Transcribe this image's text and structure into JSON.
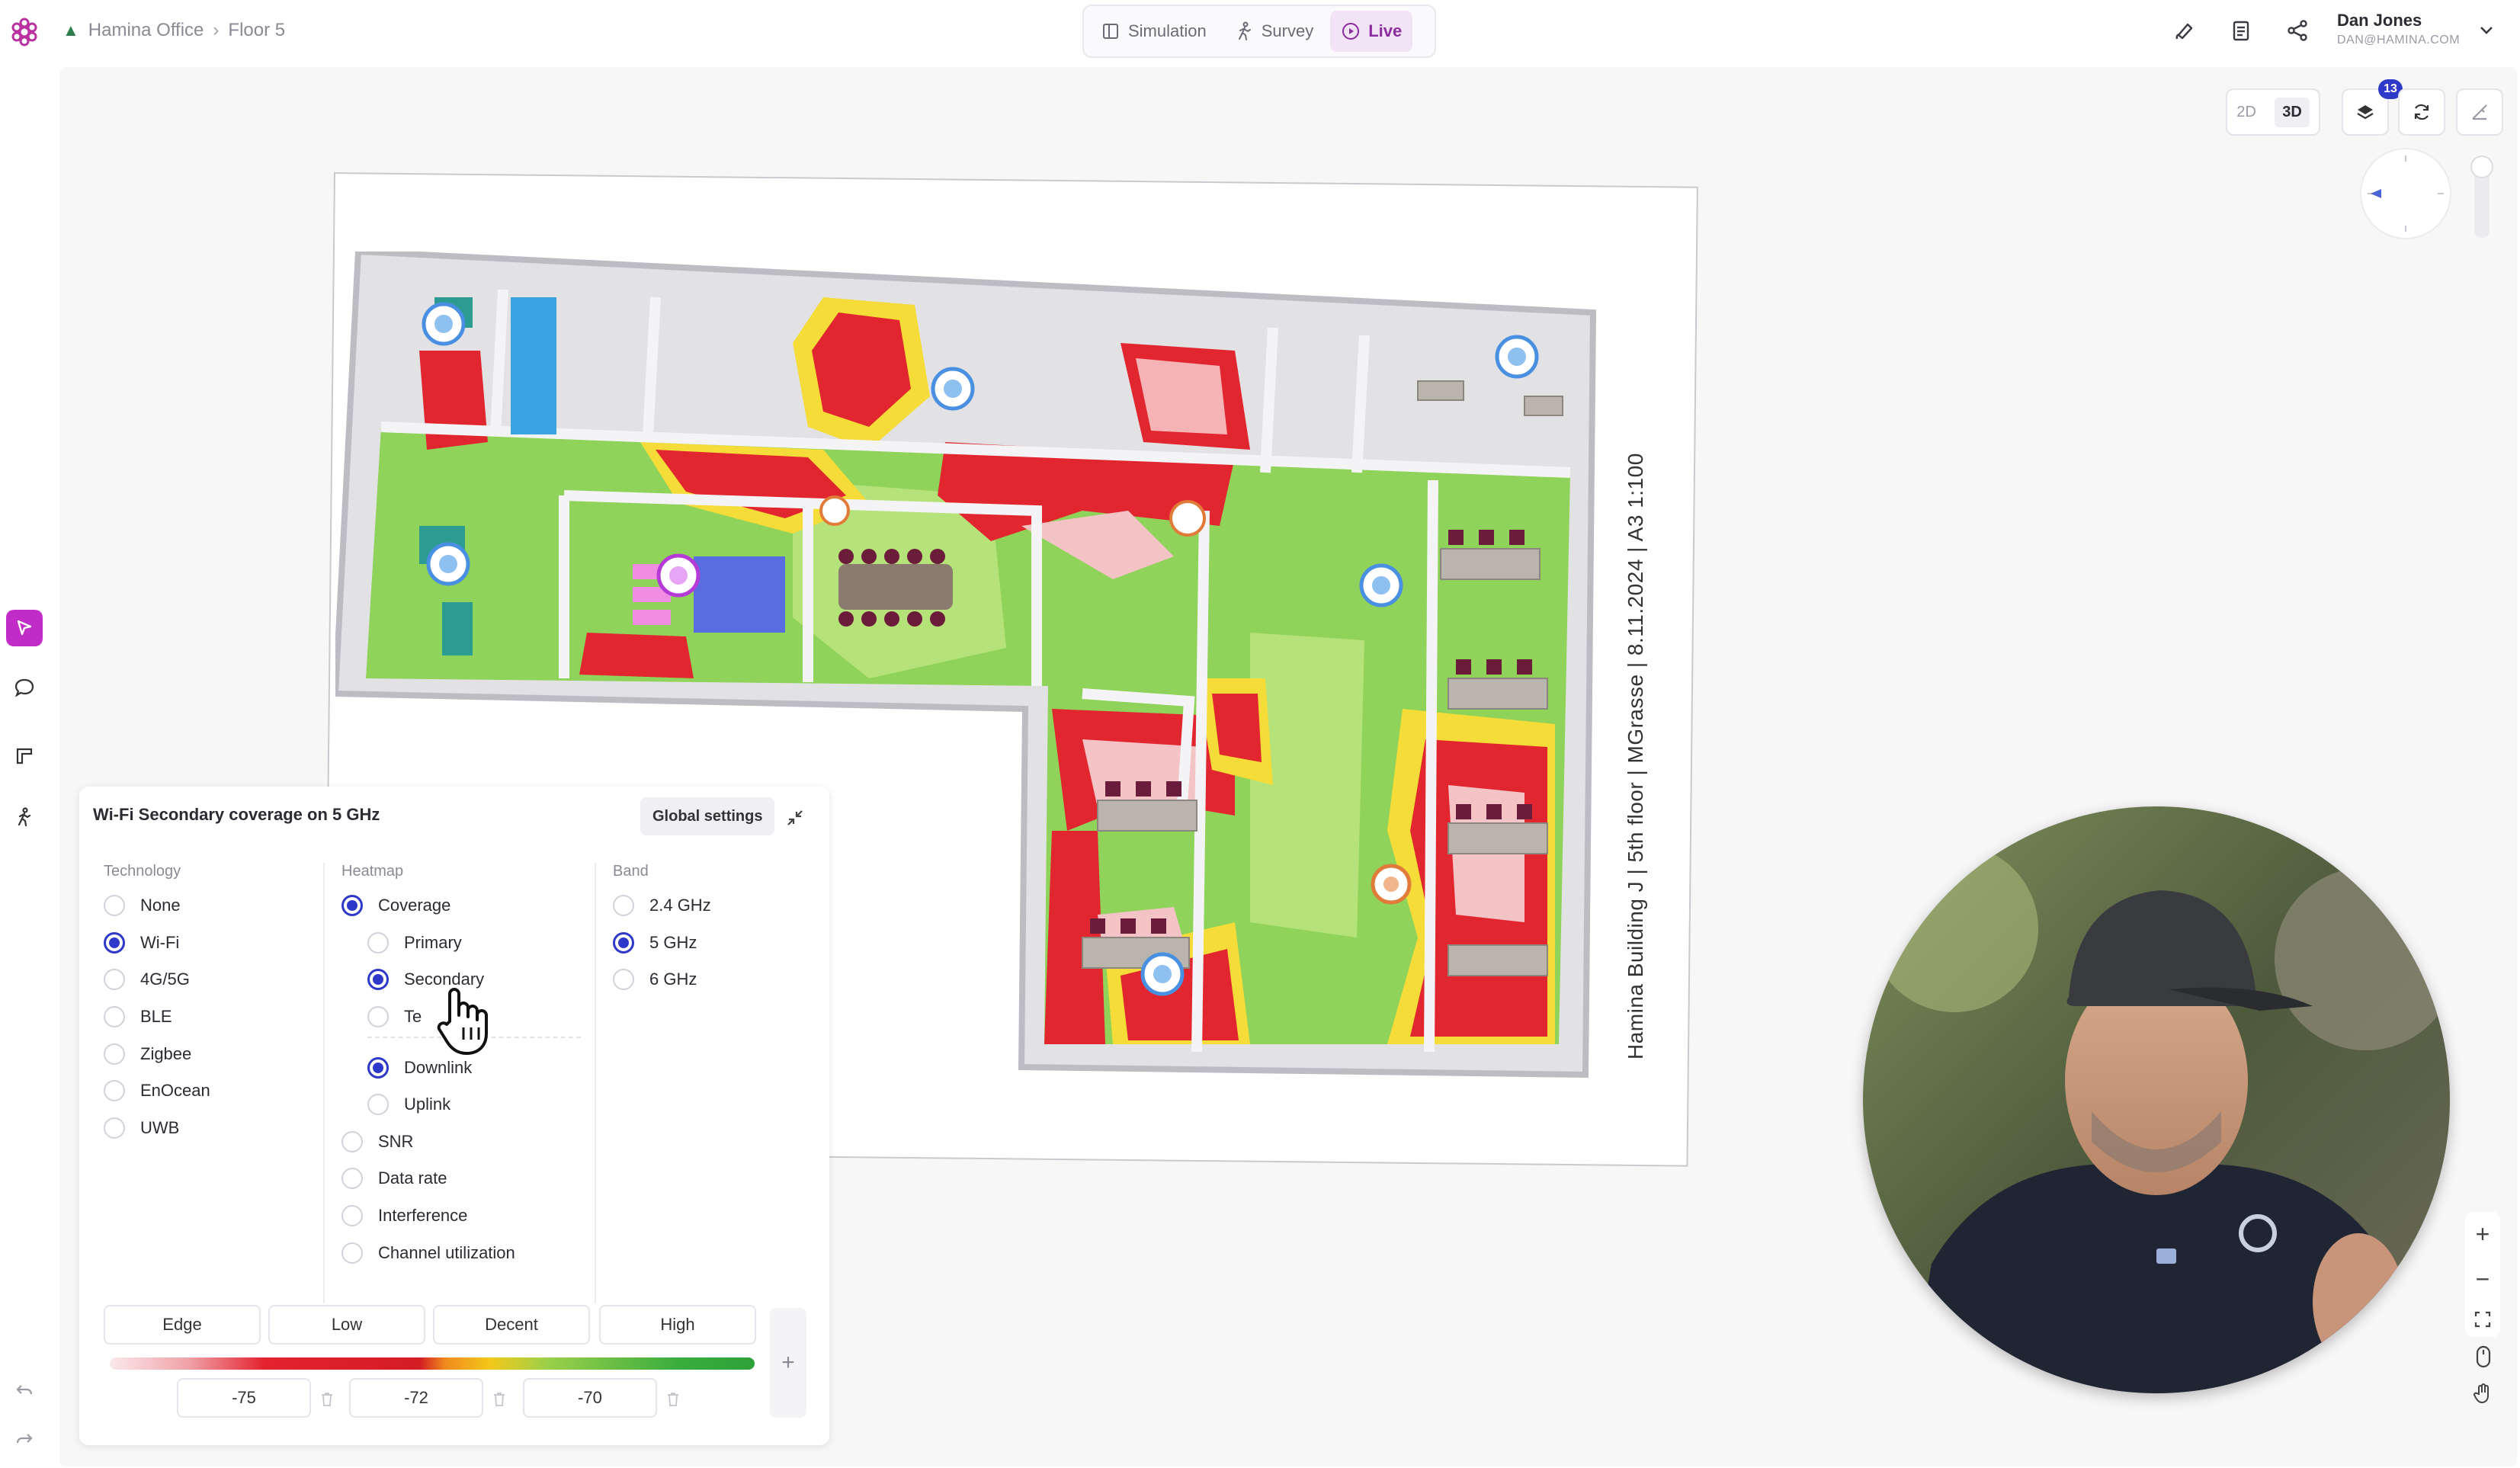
{
  "breadcrumb": {
    "project": "Hamina Office",
    "floor": "Floor 5"
  },
  "modes": [
    {
      "label": "Simulation",
      "icon": "book-icon",
      "active": false
    },
    {
      "label": "Survey",
      "icon": "walker-icon",
      "active": false
    },
    {
      "label": "Live",
      "icon": "play-circle-icon",
      "active": true
    }
  ],
  "user": {
    "name": "Dan Jones",
    "email": "DAN@HAMINA.COM"
  },
  "view": {
    "two_d": "2D",
    "three_d": "3D",
    "active": "3D",
    "layers_count": "13"
  },
  "floorplan": {
    "caption": "Hamina Building J | 5th floor | MGrasse | 8.11.2024 | A3 1:100"
  },
  "panel": {
    "title": "Wi-Fi Secondary coverage on 5 GHz",
    "global_settings": "Global settings",
    "technology": {
      "header": "Technology",
      "selected": "Wi-Fi",
      "options": [
        "None",
        "Wi-Fi",
        "4G/5G",
        "BLE",
        "Zigbee",
        "EnOcean",
        "UWB"
      ]
    },
    "heatmap": {
      "header": "Heatmap",
      "coverage": "Coverage",
      "coverage_sub": [
        "Primary",
        "Secondary",
        "Te"
      ],
      "direction": [
        "Downlink",
        "Uplink"
      ],
      "others": [
        "SNR",
        "Data rate",
        "Interference",
        "Channel utilization"
      ],
      "selected": [
        "Coverage",
        "Secondary",
        "Downlink"
      ]
    },
    "band": {
      "header": "Band",
      "selected": "5 GHz",
      "options": [
        "2.4 GHz",
        "5 GHz",
        "6 GHz"
      ]
    },
    "thresholds": {
      "labels": [
        "Edge",
        "Low",
        "Decent",
        "High"
      ],
      "values": [
        "-75",
        "-72",
        "-70"
      ],
      "add": "+"
    }
  },
  "zoom": {
    "in": "+",
    "out": "−"
  },
  "colors": {
    "accent": "#c12cc6",
    "selection_blue": "#2f39c9",
    "heat_red": "#e4232f",
    "heat_yellow": "#f4c81a",
    "heat_green": "#6ec84d"
  }
}
